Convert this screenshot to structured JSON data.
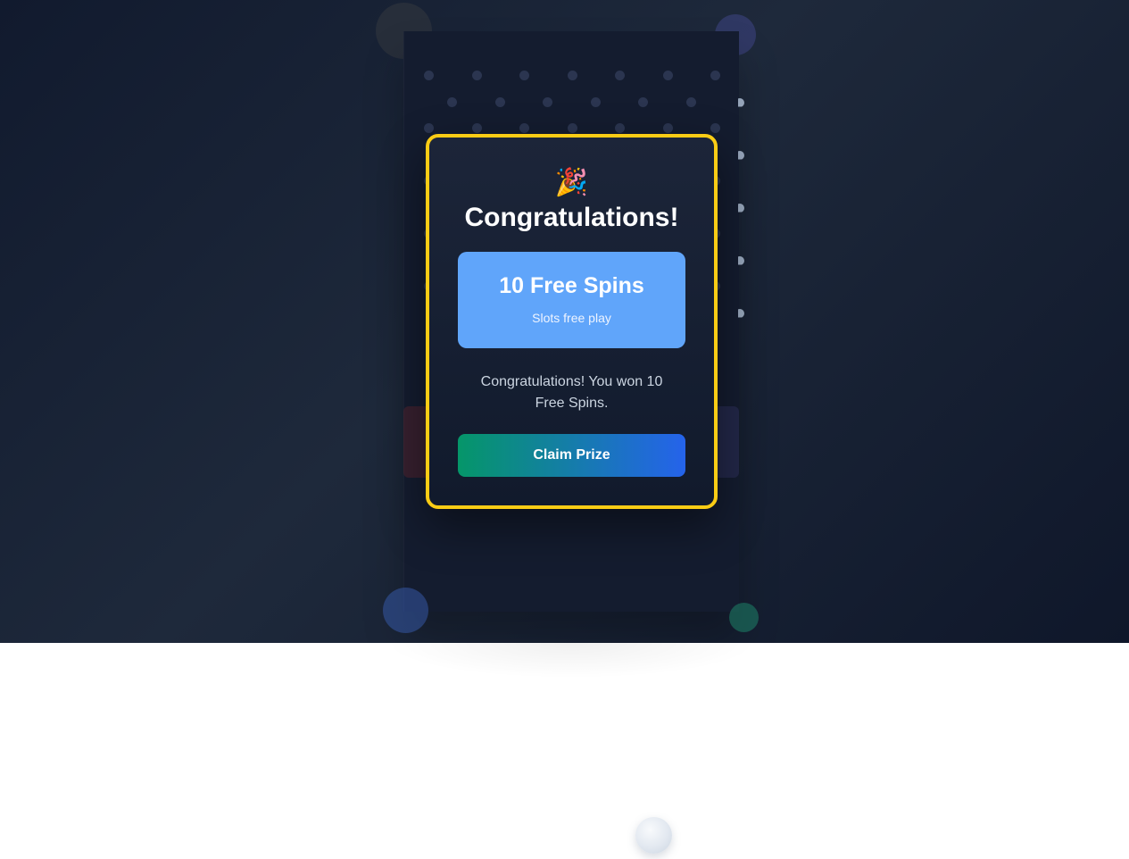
{
  "modal": {
    "emoji": "🎉",
    "title": "Congratulations!",
    "prize": {
      "name": "10 Free Spins",
      "subtitle": "Slots free play"
    },
    "message": "Congratulations! You won 10 Free Spins.",
    "claim_label": "Claim Prize"
  },
  "colors": {
    "modal_border": "#facc15",
    "prize_box": "#60a5fa",
    "claim_gradient_start": "#059669",
    "claim_gradient_end": "#2563eb",
    "background": "#1e293b"
  }
}
